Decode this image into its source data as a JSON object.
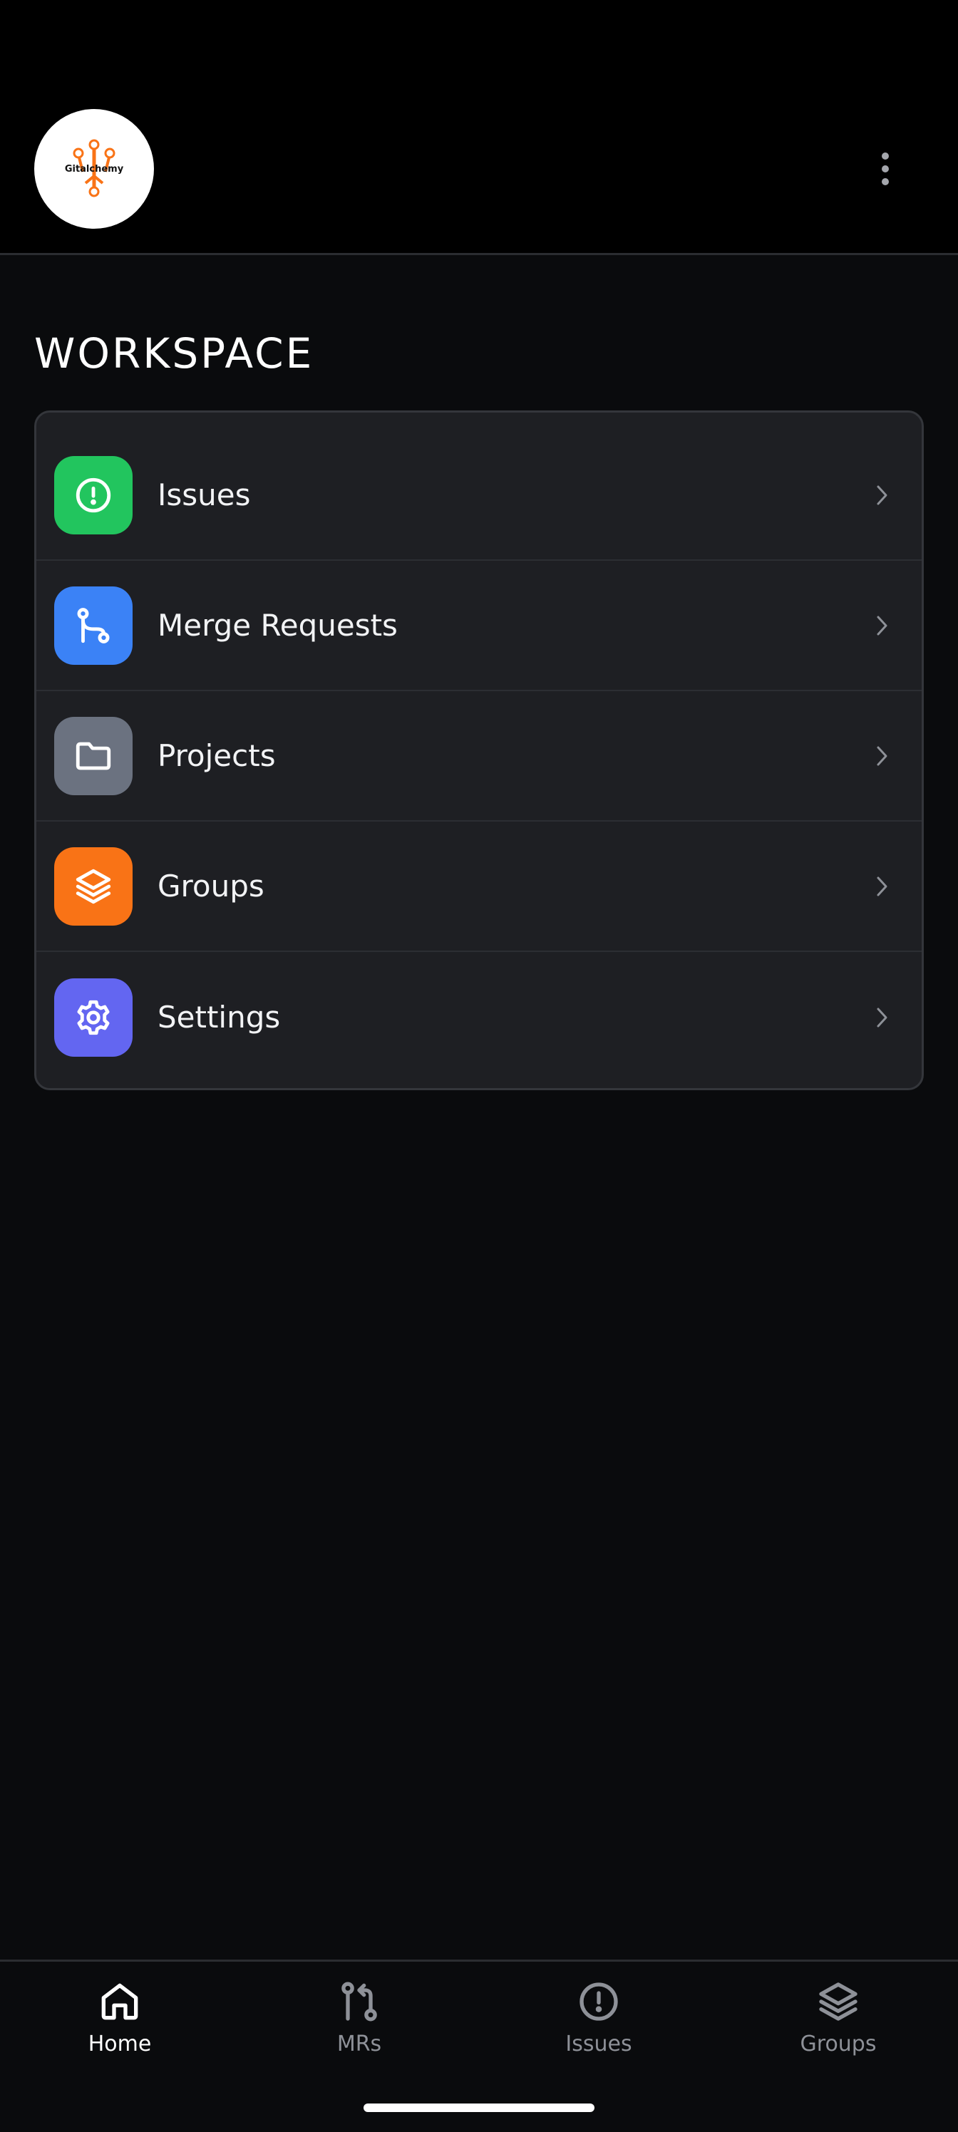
{
  "header": {
    "avatar_icon": "gitalchemy-logo",
    "avatar_logo_text": "Gitalchemy",
    "more_icon": "more-vertical-icon"
  },
  "workspace": {
    "title": "WORKSPACE",
    "items": [
      {
        "label": "Issues",
        "icon": "alert-circle-icon",
        "color": "#22c55e"
      },
      {
        "label": "Merge Requests",
        "icon": "git-merge-icon",
        "color": "#3b82f6"
      },
      {
        "label": "Projects",
        "icon": "folder-icon",
        "color": "#6b7280"
      },
      {
        "label": "Groups",
        "icon": "layers-icon",
        "color": "#f97316"
      },
      {
        "label": "Settings",
        "icon": "gear-icon",
        "color": "#6366f1"
      }
    ]
  },
  "bottom_nav": {
    "items": [
      {
        "label": "Home",
        "icon": "home-icon",
        "active": true
      },
      {
        "label": "MRs",
        "icon": "git-pull-request-icon",
        "active": false
      },
      {
        "label": "Issues",
        "icon": "alert-circle-icon",
        "active": false
      },
      {
        "label": "Groups",
        "icon": "layers-icon",
        "active": false
      }
    ]
  },
  "colors": {
    "background": "#0a0b0d",
    "header": "#000000",
    "card": "#1e1f23",
    "nav_active": "#ffffff",
    "nav_inactive": "#8e9198"
  }
}
